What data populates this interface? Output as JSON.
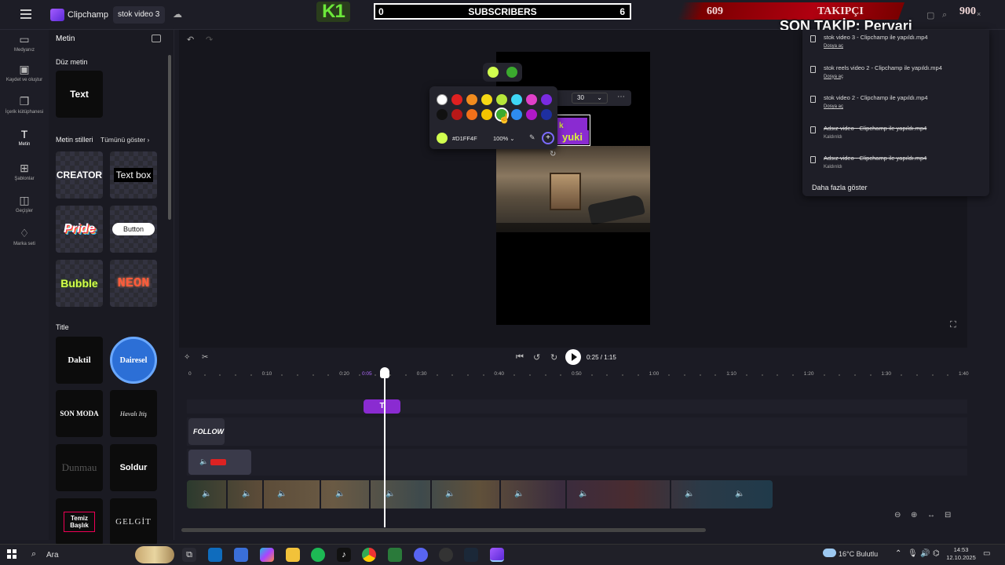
{
  "app": {
    "name": "Clipchamp",
    "project_name": "stok video 3"
  },
  "overlay": {
    "brand": "K1",
    "sub_left": "0",
    "sub_title": "SUBSCRIBERS",
    "sub_right": "6",
    "takip_left": "609",
    "takip_title": "TAKIPÇI",
    "takip_right": "900",
    "son_takip": "SON TAKİP: Pervari"
  },
  "rail": {
    "items": [
      {
        "label": "Medyanız",
        "icon": "folder-icon"
      },
      {
        "label": "Kaydet ve oluştur",
        "icon": "camera-icon"
      },
      {
        "label": "İçerik kütüphanesi",
        "icon": "library-icon"
      },
      {
        "label": "Metin",
        "icon": "text-icon"
      },
      {
        "label": "Şablonlar",
        "icon": "templates-icon"
      },
      {
        "label": "Geçişler",
        "icon": "transitions-icon"
      },
      {
        "label": "Marka seti",
        "icon": "brand-kit-icon"
      }
    ]
  },
  "panel": {
    "title": "Metin",
    "plain_text_heading": "Düz metin",
    "plain_text_tile": "Text",
    "styles_heading": "Metin stilleri",
    "show_all": "Tümünü göster",
    "styles": [
      "CREATOR",
      "Text box",
      "Pride",
      "Button",
      "Bubble",
      "NEON"
    ],
    "title_heading": "Title",
    "titles": [
      "Daktil",
      "Dairesel",
      "SON MODA",
      "Havalı Itiş",
      "Dunmau",
      "Soldur",
      "Temiz Başlık",
      "GELGİT"
    ]
  },
  "editor": {
    "font_size": "30",
    "overlay_text_top": "k",
    "overlay_text_bottom": "yuki"
  },
  "color_picker": {
    "recent": [
      "#D1FF4F",
      "#3BAA2E"
    ],
    "row1": [
      "#FFFFFF",
      "#E02020",
      "#F28C1E",
      "#F5D815",
      "#B6E63A",
      "#3FD6F5",
      "#E040C8",
      "#7A2BE0"
    ],
    "row2": [
      "#111111",
      "#B81818",
      "#F0701A",
      "#F2C300",
      "#3BAA2E",
      "#2E8CF0",
      "#B018C8",
      "#1E2FA0"
    ],
    "hex": "#D1FF4F",
    "opacity": "100%"
  },
  "notifications": {
    "items": [
      {
        "title": "stok video 3 - Clipchamp ile yapıldı.mp4",
        "action": "Dosya aç",
        "strike": false
      },
      {
        "title": "stok reels video 2 - Clipchamp ile yapıldı.mp4",
        "action": "Dosya aç",
        "strike": false
      },
      {
        "title": "stok video 2 - Clipchamp ile yapıldı.mp4",
        "action": "Dosya aç",
        "strike": false
      },
      {
        "title": "Adsız video - Clipchamp ile yapıldı.mp4",
        "action": "Kaldırıldı",
        "strike": true
      },
      {
        "title": "Adsız video - Clipchamp ile yapıldı.mp4",
        "action": "Kaldırıldı",
        "strike": true
      }
    ],
    "more": "Daha fazla göster"
  },
  "transport": {
    "time": "0:25 / 1:15"
  },
  "timeline": {
    "ticks": [
      "0",
      "0:10",
      "0:20",
      "0:30",
      "0:40",
      "0:50",
      "1:00",
      "1:10",
      "1:20",
      "1:30",
      "1:40"
    ],
    "playhead_label": "0:05",
    "text_clip": "T",
    "follow_clip": "FOLLOW"
  },
  "taskbar": {
    "search": "Ara",
    "weather": "16°C Bulutlu",
    "time": "14:53",
    "date": "12.10.2025"
  }
}
